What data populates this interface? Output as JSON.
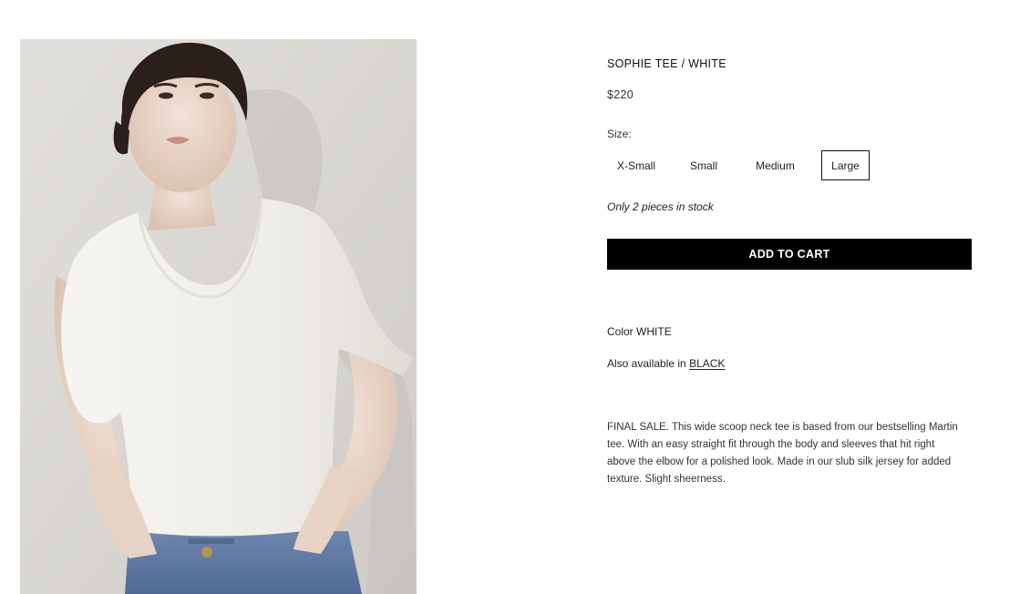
{
  "product": {
    "title": "SOPHIE TEE / WHITE",
    "price": "$220",
    "size_label": "Size:",
    "sizes": [
      "X-Small",
      "Small",
      "Medium",
      "Large"
    ],
    "selected_size": "Large",
    "stock_note": "Only 2 pieces in stock",
    "add_to_cart_label": "ADD TO CART",
    "color_prefix": "Color",
    "color_value": "WHITE",
    "also_available_prefix": "Also available in",
    "also_available_link": "BLACK",
    "description": "FINAL SALE. This wide scoop neck tee is based from our bestselling Martin tee. With an easy straight fit through the body and sleeves that hit right above the elbow for a polished look. Made in our slub silk jersey for added texture. Slight sheerness."
  },
  "colors": {
    "button_bg": "#000000",
    "button_text": "#ffffff",
    "selected_border": "#111111",
    "image_bg": "#dcdad6"
  }
}
